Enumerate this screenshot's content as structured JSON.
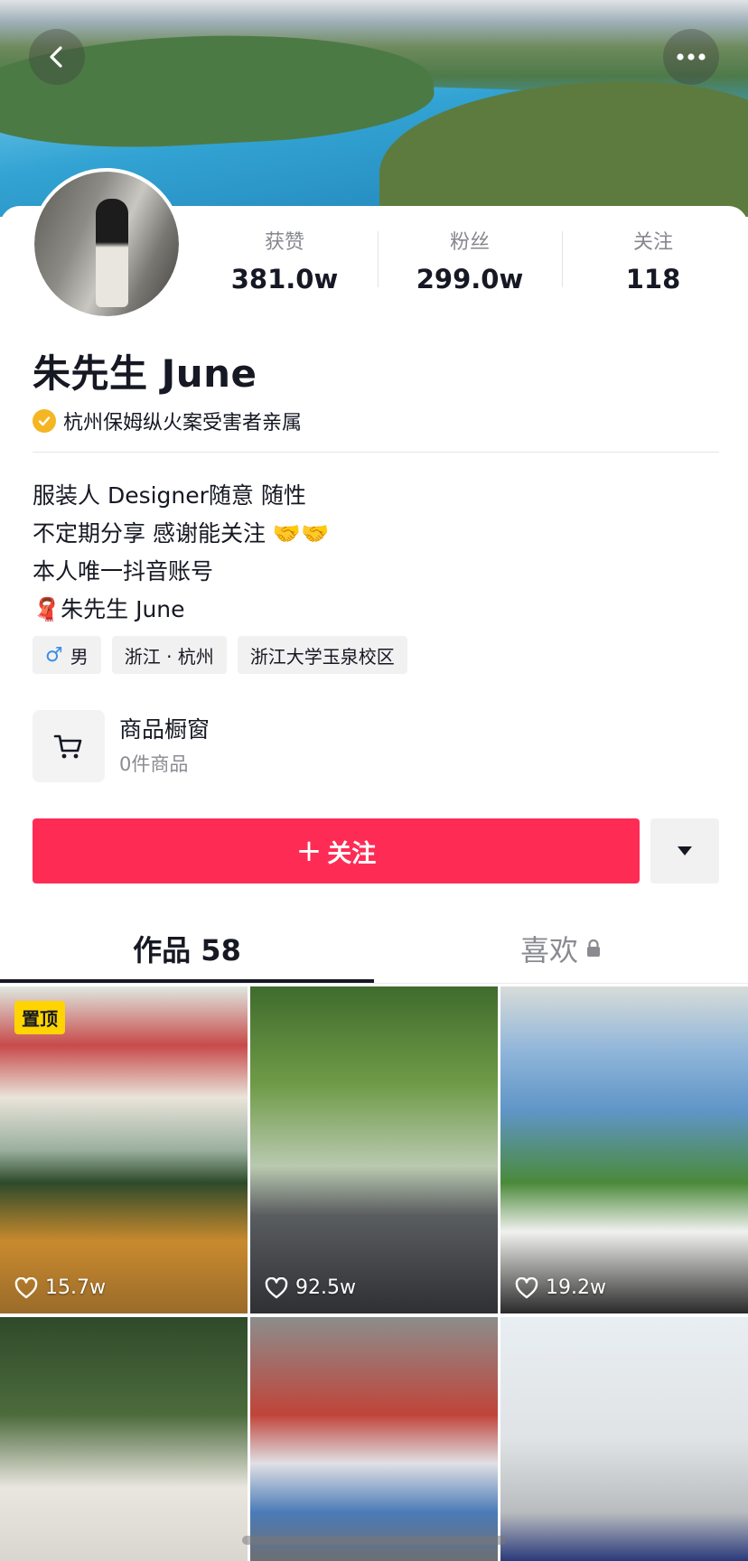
{
  "stats": [
    {
      "label": "获赞",
      "value": "381.0w"
    },
    {
      "label": "粉丝",
      "value": "299.0w"
    },
    {
      "label": "关注",
      "value": "118"
    }
  ],
  "profile": {
    "name": "朱先生 June",
    "verification": "杭州保姆纵火案受害者亲属",
    "bio": [
      "服装人 Designer随意 随性",
      "不定期分享 感谢能关注 🤝🤝",
      "本人唯一抖音账号",
      "🧣朱先生 June"
    ],
    "tags": {
      "gender_symbol": "♂",
      "gender": "男",
      "location": "浙江 · 杭州",
      "school": "浙江大学玉泉校区"
    }
  },
  "shop": {
    "title": "商品橱窗",
    "subtitle": "0件商品"
  },
  "actions": {
    "follow_label": "关注",
    "follow_plus": "+"
  },
  "tabs": {
    "works": "作品 58",
    "likes": "喜欢"
  },
  "videos": [
    {
      "likes": "15.7w",
      "pinned": "置顶"
    },
    {
      "likes": "92.5w"
    },
    {
      "likes": "19.2w"
    },
    {},
    {},
    {}
  ],
  "colors": {
    "accent": "#fe2c55",
    "pin": "#ffd400",
    "verify": "#f5b623",
    "male": "#3a8ee6"
  }
}
